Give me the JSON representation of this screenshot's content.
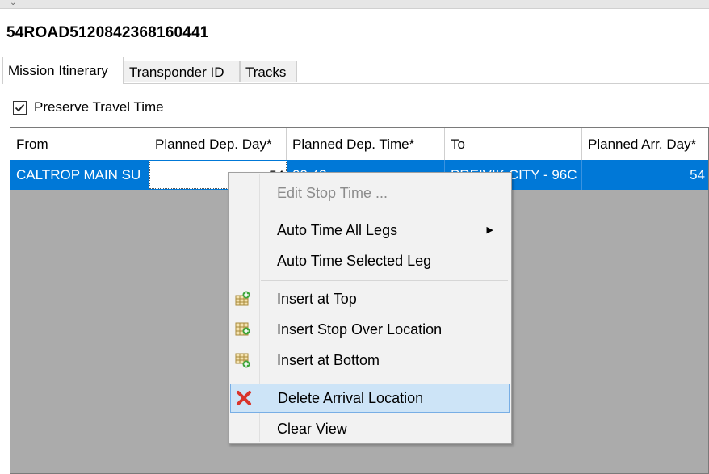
{
  "record_id": "54ROAD5120842368160441",
  "tabs": [
    {
      "label": "Mission Itinerary",
      "active": true
    },
    {
      "label": "Transponder ID",
      "active": false
    },
    {
      "label": "Tracks",
      "active": false
    }
  ],
  "preserve_travel_time": {
    "label": "Preserve Travel Time",
    "checked": true
  },
  "grid": {
    "columns": [
      "From",
      "Planned Dep. Day*",
      "Planned Dep. Time*",
      "To",
      "Planned Arr. Day*"
    ],
    "rows": [
      {
        "from": "CALTROP MAIN SU",
        "dep_day": "54",
        "dep_time": "09:43",
        "to": "PREIVIK CITY - 96C",
        "arr_day": "54"
      }
    ]
  },
  "context_menu": {
    "items": [
      {
        "label": "Edit Stop Time ...",
        "enabled": false
      },
      {
        "label": "Auto Time All Legs",
        "submenu": true
      },
      {
        "label": "Auto Time Selected Leg"
      },
      {
        "label": "Insert at Top",
        "icon": "insert-top-icon"
      },
      {
        "label": "Insert Stop Over Location",
        "icon": "insert-middle-icon"
      },
      {
        "label": "Insert at Bottom",
        "icon": "insert-bottom-icon"
      },
      {
        "label": "Delete Arrival Location",
        "icon": "delete-x-icon",
        "highlighted": true
      },
      {
        "label": "Clear View"
      }
    ],
    "submenu_arrow": "▶"
  },
  "colors": {
    "selection": "#0078d7",
    "menu_hover": "#cde4f7",
    "delete_icon": "#d9342b"
  }
}
